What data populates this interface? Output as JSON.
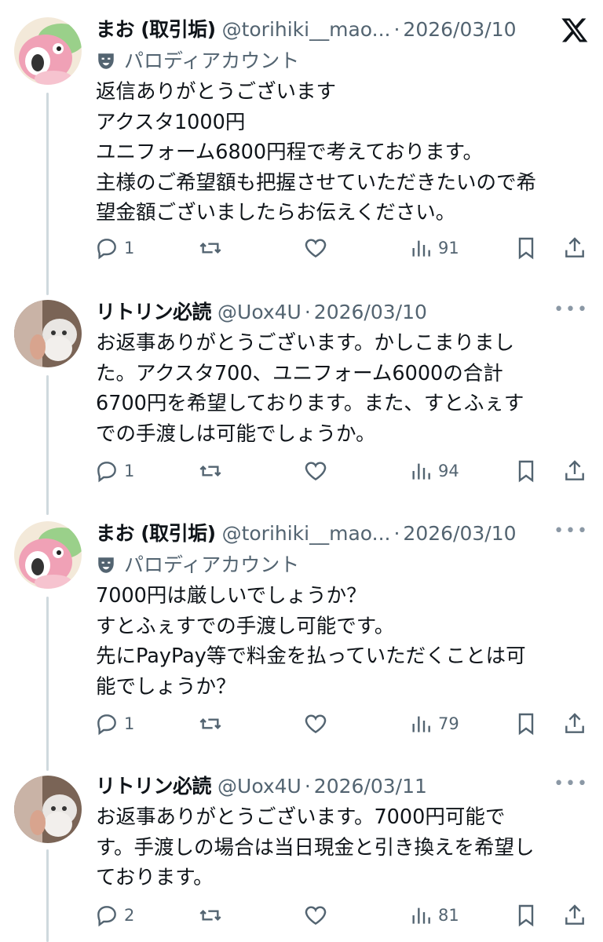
{
  "app": {
    "logo_icon": "x-logo-icon"
  },
  "tweets": [
    {
      "name": "まお (取引垢)",
      "handle": "@torihiki__mao...",
      "date": "2026/03/10",
      "parody_label": "パロディアカウント",
      "lines": [
        "返信ありがとうございます",
        "アクスタ1000円",
        "ユニフォーム6800円程で考えております。",
        "主様のご希望額も把握させていただきたいので希",
        "望金額ございましたらお伝えください。"
      ],
      "replies": "1",
      "views": "91"
    },
    {
      "name": "リトリン必読",
      "handle": "@Uox4U",
      "date": "2026/03/10",
      "lines": [
        "お返事ありがとうございます。かしこまりまし",
        "た。アクスタ700、ユニフォーム6000の合計",
        "6700円を希望しております。また、すとふぇす",
        "での手渡しは可能でしょうか。"
      ],
      "replies": "1",
      "views": "94"
    },
    {
      "name": "まお (取引垢)",
      "handle": "@torihiki__mao...",
      "date": "2026/03/10",
      "parody_label": "パロディアカウント",
      "lines": [
        "7000円は厳しいでしょうか？",
        "すとふぇすでの手渡し可能です。",
        "先にPayPay等で料金を払っていただくことは可",
        "能でしょうか？"
      ],
      "replies": "1",
      "views": "79"
    },
    {
      "name": "リトリン必読",
      "handle": "@Uox4U",
      "date": "2026/03/11",
      "lines": [
        "お返事ありがとうございます。7000円可能で",
        "す。手渡しの場合は当日現金と引き換えを希望し",
        "ております。"
      ],
      "replies": "2",
      "views": "81"
    }
  ],
  "separator": "·"
}
